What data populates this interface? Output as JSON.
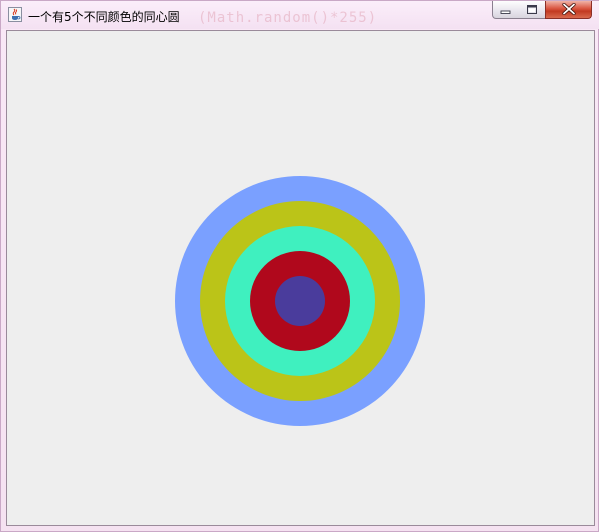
{
  "window": {
    "title": "一个有5个不同颜色的同心圆",
    "background_code_text": "(Math.random()*255)"
  },
  "titlebar": {
    "icon": "java-cup-icon",
    "buttons": [
      {
        "name": "minimize",
        "icon": "minimize-icon"
      },
      {
        "name": "maximize",
        "icon": "maximize-icon"
      },
      {
        "name": "close",
        "icon": "close-icon"
      }
    ]
  },
  "drawing": {
    "background_color": "#eeeeee",
    "rings": [
      {
        "color": "#7aa0ff",
        "radius_fraction": 1.0
      },
      {
        "color": "#bbc418",
        "radius_fraction": 0.8
      },
      {
        "color": "#3ff0bf",
        "radius_fraction": 0.6
      },
      {
        "color": "#b0081c",
        "radius_fraction": 0.4
      },
      {
        "color": "#4a3c9c",
        "radius_fraction": 0.2
      }
    ]
  }
}
